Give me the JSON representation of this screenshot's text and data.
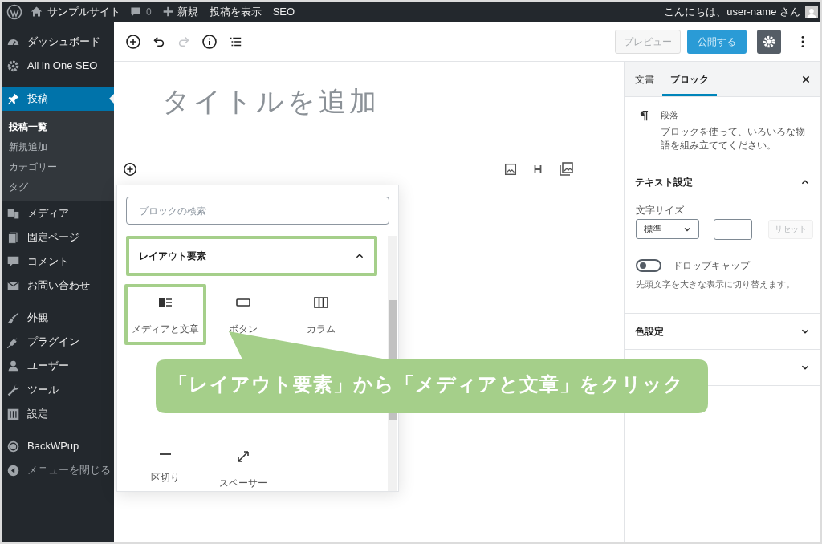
{
  "admin_bar": {
    "site_name": "サンプルサイト",
    "comments": "0",
    "new": "新規",
    "view_post": "投稿を表示",
    "seo": "SEO",
    "greeting": "こんにちは、user-name さん"
  },
  "sidebar": {
    "groups": [
      {
        "items": [
          {
            "kind": "menu",
            "label": "ダッシュボード",
            "selected": false
          },
          {
            "kind": "menu",
            "label": "All in One SEO",
            "selected": false
          }
        ]
      },
      {
        "items": [
          {
            "kind": "menu",
            "label": "投稿",
            "selected": true,
            "children": [
              {
                "label": "投稿一覧",
                "selected": true
              },
              {
                "label": "新規追加",
                "selected": false
              },
              {
                "label": "カテゴリー",
                "selected": false
              },
              {
                "label": "タグ",
                "selected": false
              }
            ]
          }
        ]
      },
      {
        "items": [
          {
            "kind": "menu",
            "label": "メディア",
            "selected": false
          },
          {
            "kind": "menu",
            "label": "固定ページ",
            "selected": false
          },
          {
            "kind": "menu",
            "label": "コメント",
            "selected": false
          },
          {
            "kind": "menu",
            "label": "お問い合わせ",
            "selected": false
          }
        ]
      },
      {
        "items": [
          {
            "kind": "menu",
            "label": "外観",
            "selected": false
          },
          {
            "kind": "menu",
            "label": "プラグイン",
            "selected": false
          },
          {
            "kind": "menu",
            "label": "ユーザー",
            "selected": false
          },
          {
            "kind": "menu",
            "label": "ツール",
            "selected": false
          },
          {
            "kind": "menu",
            "label": "設定",
            "selected": false
          }
        ]
      },
      {
        "items": [
          {
            "kind": "menu",
            "label": "BackWPup",
            "selected": false
          },
          {
            "kind": "collapse",
            "label": "メニューを閉じる",
            "selected": false
          }
        ]
      }
    ]
  },
  "toolbar": {
    "redo_disabled": true,
    "preview": "プレビュー",
    "publish": "公開する",
    "settings_open": true
  },
  "editor": {
    "title_placeholder": "タイトルを追加"
  },
  "inserter": {
    "search": {
      "placeholder": "ブロックの検索"
    },
    "category": {
      "title": "レイアウト要素",
      "expanded": true,
      "highlighted": true
    },
    "blocks": [
      {
        "label": "メディアと文章",
        "highlighted": true
      },
      {
        "label": "ボタン",
        "highlighted": false
      },
      {
        "label": "カラム",
        "highlighted": false
      },
      {
        "label": "区切り",
        "highlighted": false
      },
      {
        "label": "スペーサー",
        "highlighted": false
      }
    ]
  },
  "settings_panel": {
    "tabs": [
      {
        "label": "文書",
        "selected": false
      },
      {
        "label": "ブロック",
        "selected": true
      }
    ],
    "block_card": {
      "title": "段落",
      "description": "ブロックを使って、いろいろな物語を組み立ててください。"
    },
    "sections": [
      {
        "title": "テキスト設定",
        "expanded": true
      },
      {
        "title": "色設定",
        "expanded": false
      },
      {
        "expanded": false
      }
    ],
    "text_settings": {
      "font_size_label": "文字サイズ",
      "font_size": "標準",
      "reset": "リセット",
      "reset_disabled": true,
      "drop_cap": {
        "label": "ドロップキャップ",
        "on": false,
        "help": "先頭文字を大きな表示に切り替えます。"
      }
    }
  },
  "callout": {
    "text": "「レイアウト要素」から「メディアと文章」をクリック"
  }
}
